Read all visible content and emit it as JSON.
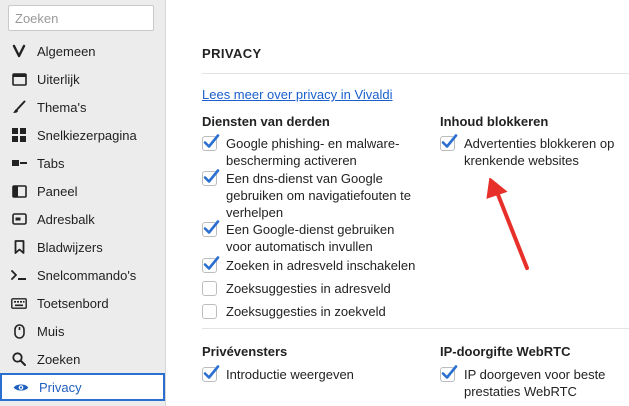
{
  "sidebar": {
    "search_placeholder": "Zoeken",
    "items": [
      {
        "label": "Algemeen",
        "icon": "vivaldi-v-icon"
      },
      {
        "label": "Uiterlijk",
        "icon": "window-icon"
      },
      {
        "label": "Thema's",
        "icon": "brush-icon"
      },
      {
        "label": "Snelkiezerpagina",
        "icon": "grid-icon"
      },
      {
        "label": "Tabs",
        "icon": "tabs-icon"
      },
      {
        "label": "Paneel",
        "icon": "panel-icon"
      },
      {
        "label": "Adresbalk",
        "icon": "addressbar-icon"
      },
      {
        "label": "Bladwijzers",
        "icon": "bookmark-icon"
      },
      {
        "label": "Snelcommando's",
        "icon": "command-icon"
      },
      {
        "label": "Toetsenbord",
        "icon": "keyboard-icon"
      },
      {
        "label": "Muis",
        "icon": "mouse-icon"
      },
      {
        "label": "Zoeken",
        "icon": "search-icon"
      },
      {
        "label": "Privacy",
        "icon": "eye-icon",
        "active": true
      }
    ]
  },
  "main": {
    "title": "PRIVACY",
    "link": "Lees meer over privacy in Vivaldi",
    "third_party": {
      "title": "Diensten van derden",
      "options": [
        {
          "label": "Google phishing- en malware-bescherming activeren",
          "checked": true
        },
        {
          "label": "Een dns-dienst van Google gebruiken om navigatiefouten te verhelpen",
          "checked": true
        },
        {
          "label": "Een Google-dienst gebruiken voor automatisch invullen",
          "checked": true
        },
        {
          "label": "Zoeken in adresveld inschakelen",
          "checked": true
        },
        {
          "label": "Zoeksuggesties in adresveld",
          "checked": false
        },
        {
          "label": "Zoeksuggesties in zoekveld",
          "checked": false
        }
      ]
    },
    "content_blocking": {
      "title": "Inhoud blokkeren",
      "options": [
        {
          "label": "Advertenties blokkeren op krenkende websites",
          "checked": true
        }
      ]
    },
    "private_windows": {
      "title": "Privévensters",
      "options": [
        {
          "label": "Introductie weergeven",
          "checked": true
        }
      ]
    },
    "webrtc": {
      "title": "IP-doorgifte WebRTC",
      "options": [
        {
          "label": "IP doorgeven voor beste prestaties WebRTC",
          "checked": true
        }
      ]
    }
  },
  "colors": {
    "accent": "#2b6fd1",
    "link": "#1a5fcc",
    "arrow": "#e8302a",
    "sidebar_bg": "#ececec"
  }
}
